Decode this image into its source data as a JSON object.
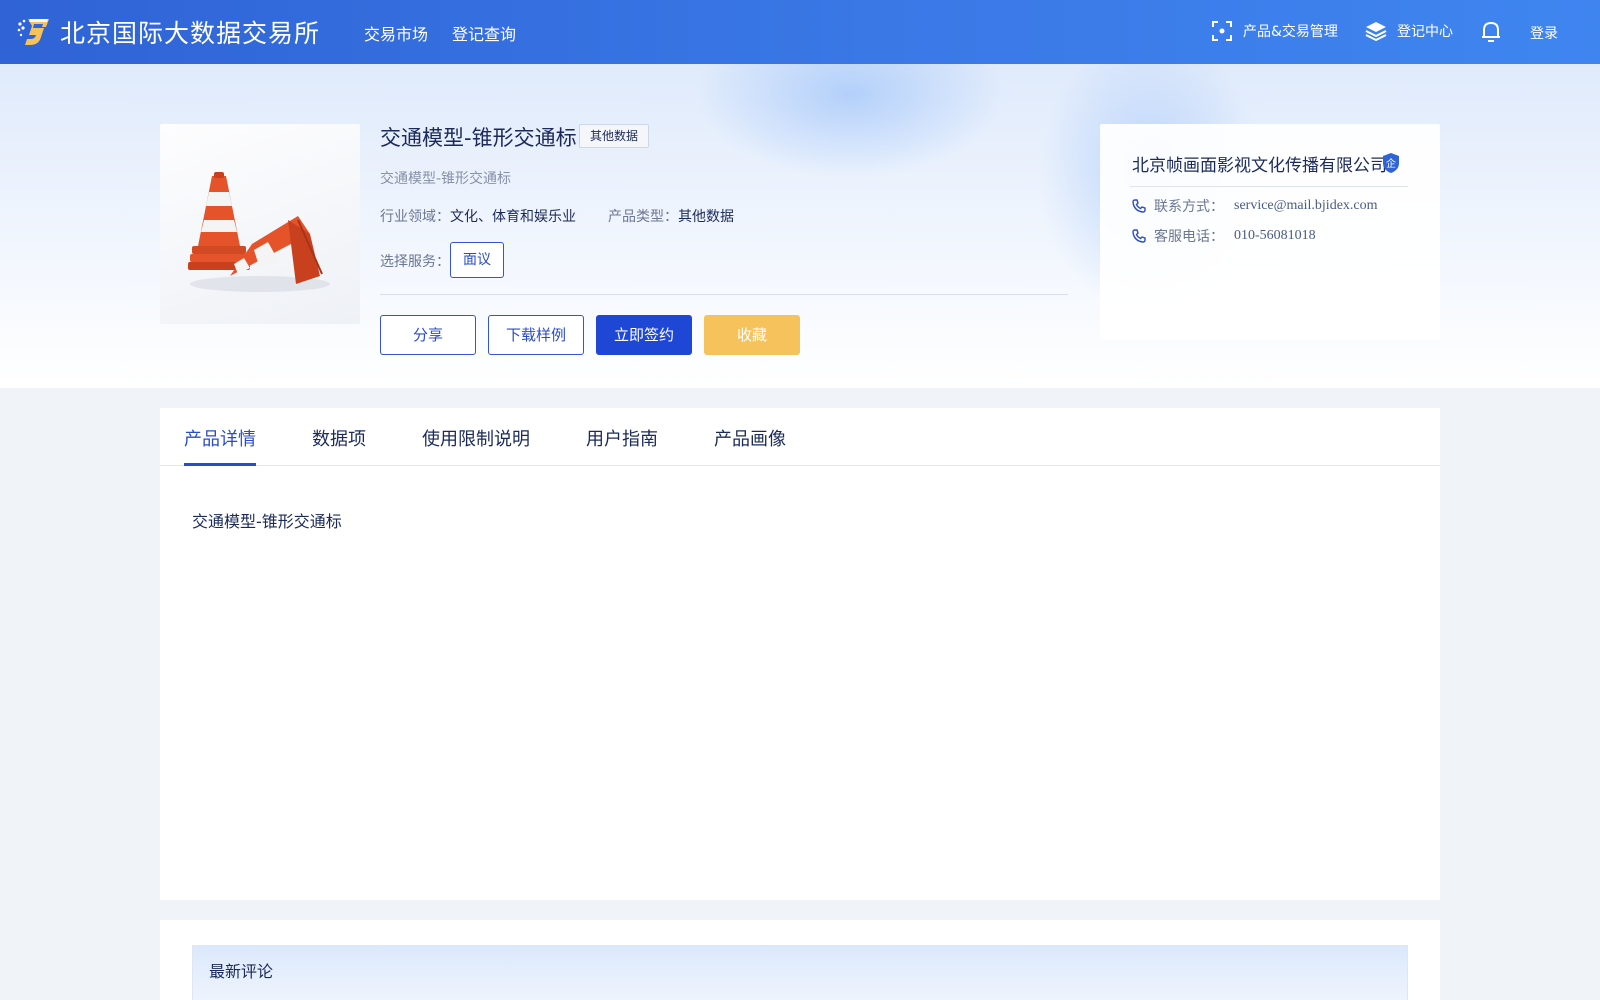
{
  "header": {
    "brand": "北京国际大数据交易所",
    "nav": [
      "交易市场",
      "登记查询"
    ],
    "product_mgmt": "产品&交易管理",
    "register_center": "登记中心",
    "login": "登录"
  },
  "product": {
    "title": "交通模型-锥形交通标",
    "tag": "其他数据",
    "subtitle": "交通模型-锥形交通标",
    "industry_label": "行业领域：",
    "industry_value": "文化、体育和娱乐业",
    "type_label": "产品类型：",
    "type_value": "其他数据",
    "service_label": "选择服务：",
    "service_option": "面议",
    "buttons": {
      "share": "分享",
      "download_sample": "下载样例",
      "sign": "立即签约",
      "favorite": "收藏"
    }
  },
  "company": {
    "name": "北京帧画面影视文化传播有限公司",
    "badge": "企",
    "contact_label": "联系方式：",
    "contact_value": "service@mail.bjidex.com",
    "phone_label": "客服电话：",
    "phone_value": "010-56081018"
  },
  "tabs": [
    "产品详情",
    "数据项",
    "使用限制说明",
    "用户指南",
    "产品画像"
  ],
  "active_tab": "产品详情",
  "detail": {
    "text": "交通模型-锥形交通标"
  },
  "comments": {
    "title": "最新评论"
  },
  "colors": {
    "primary": "#1f47d6",
    "favorite": "#f5c25b",
    "header": "#3a78e6"
  }
}
